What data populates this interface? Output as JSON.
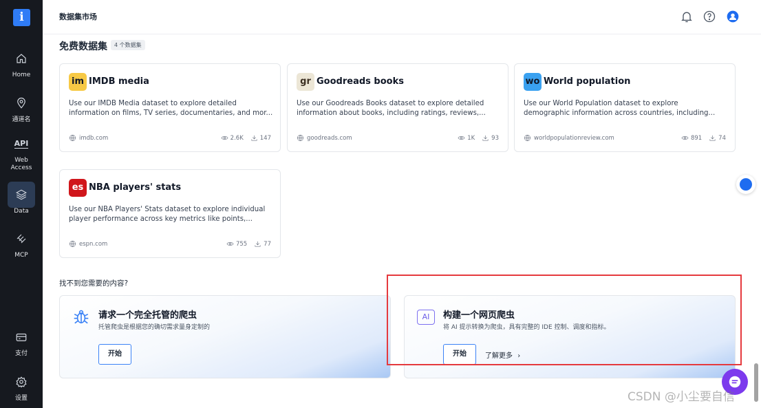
{
  "logo": {
    "glyph": "i"
  },
  "sidebar": {
    "items": [
      {
        "label": "Home",
        "icon": "home-icon"
      },
      {
        "label": "通道名",
        "icon": "location-pin-icon"
      },
      {
        "label": "Web Access",
        "icon": "api-icon",
        "icon_text": "API"
      },
      {
        "label": "Data",
        "icon": "layers-icon",
        "active": true
      },
      {
        "label": "MCP",
        "icon": "mcp-icon"
      },
      {
        "label": "支付",
        "icon": "card-icon"
      },
      {
        "label": "设置",
        "icon": "gear-icon"
      }
    ]
  },
  "header": {
    "title": "数据集市场"
  },
  "section": {
    "title": "免费数据集",
    "count": "4 个数据集"
  },
  "cards": [
    {
      "badge": "im",
      "badge_bg": "#f7c945",
      "badge_fg": "#111827",
      "title": "IMDB media",
      "desc_line1": "Use our IMDB Media dataset to explore detailed",
      "desc_line2": "information on films, TV series, documentaries, and mor...",
      "domain": "imdb.com",
      "views": "2.6K",
      "downloads": "147"
    },
    {
      "badge": "gr",
      "badge_bg": "#ece6d6",
      "badge_fg": "#3b2f22",
      "title": "Goodreads books",
      "desc_line1": "Use our Goodreads Books dataset to explore detailed",
      "desc_line2": "information about books, including ratings, reviews,...",
      "domain": "goodreads.com",
      "views": "1K",
      "downloads": "93"
    },
    {
      "badge": "wo",
      "badge_bg": "#3aa1f0",
      "badge_fg": "#111827",
      "title": "World population",
      "desc_line1": "Use our World Population dataset to explore",
      "desc_line2": "demographic information across countries, including...",
      "domain": "worldpopulationreview.com",
      "views": "891",
      "downloads": "74"
    },
    {
      "badge": "es",
      "badge_bg": "#d0161b",
      "badge_fg": "#ffffff",
      "title": "NBA players' stats",
      "desc_line1": "Use our NBA Players' Stats dataset to explore individual",
      "desc_line2": "player performance across key metrics like points,...",
      "domain": "espn.com",
      "views": "755",
      "downloads": "77"
    }
  ],
  "bottom": {
    "label": "找不到您需要的内容?",
    "promo1": {
      "title": "请求一个完全托管的爬虫",
      "desc": "托管爬虫是根据您的确切需求量身定制的",
      "start": "开始",
      "icon": "bug-icon"
    },
    "promo2": {
      "title": "构建一个网页爬虫",
      "desc": "将 AI 提示转换为爬虫，具有完整的 IDE 控制、调度和指标。",
      "start": "开始",
      "learn_more": "了解更多",
      "icon_text": "AI"
    }
  },
  "watermark": "CSDN @小尘要自信"
}
